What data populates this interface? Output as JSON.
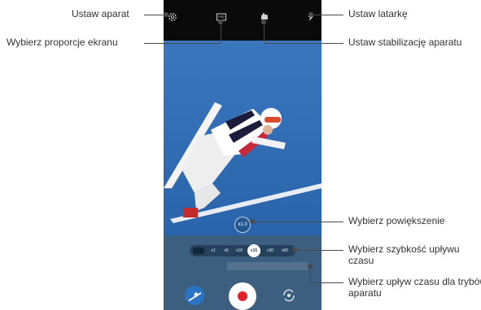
{
  "annotations": {
    "set_camera": "Ustaw aparat",
    "aspect_ratio": "Wybierz proporcje ekranu",
    "set_flash": "Ustaw latarkę",
    "set_stabilization": "Ustaw stabilizację aparatu",
    "select_zoom": "Wybierz powiększenie",
    "select_speed": "Wybierz szybkość upływu czasu",
    "select_timelapse_mode": "Wybierz upływ czasu dla trybów aparatu"
  },
  "camera": {
    "aspect_badge": "FHD",
    "zoom_value": "x1.0",
    "speed_options": [
      "x1",
      "x5",
      "x10",
      "x15",
      "x30",
      "x60"
    ],
    "selected_speed": "x15"
  },
  "colors": {
    "sky": "#1e5fa8",
    "bottom_panel": "#3c5f80",
    "record": "#e0202a"
  }
}
